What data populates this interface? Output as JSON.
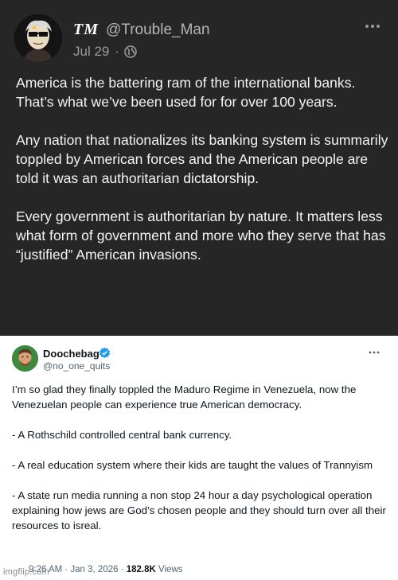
{
  "tm_post": {
    "display_name": "TM",
    "handle": "@Trouble_Man",
    "date": "Jul 29",
    "separator": "·",
    "paragraphs": [
      "America is the battering ram of the international banks. That’s what we’ve been used for for over 100 years.",
      "Any nation that nationalizes its banking system is summarily toppled by American forces and the American people are told it was an authoritarian dictatorship.",
      "Every government is authoritarian by nature. It matters less what form of government and more who they serve that has “justified” American invasions."
    ],
    "icons": {
      "audience": "globe-icon",
      "menu": "more-icon"
    },
    "colors": {
      "background": "#262626",
      "text": "#f4f4f4",
      "muted": "#9a9a9a"
    }
  },
  "embedded_post": {
    "display_name": "Doochebag",
    "handle": "@no_one_quits",
    "paragraphs": [
      "I’m so glad they finally toppled the Maduro Regime in Venezuela, now the Venezuelan people can experience true American democracy.",
      "- A Rothschild controlled central bank currency.",
      "- A real education system where their kids are taught the values of Trannyism",
      "- A state run media running a non stop 24 hour a day psychological operation explaining how jews are God’s chosen people and they should turn over all their resources to isreal."
    ],
    "timestamp": "9:26 AM · Jan 3, 2026 · ",
    "views_count": "182.8K",
    "views_label": " Views",
    "icons": {
      "badge": "verified-icon",
      "menu": "more-icon"
    },
    "colors": {
      "verified": "#1d9bf0",
      "text": "#0f1419",
      "muted": "#536471"
    }
  },
  "watermark": "imgflip.com"
}
